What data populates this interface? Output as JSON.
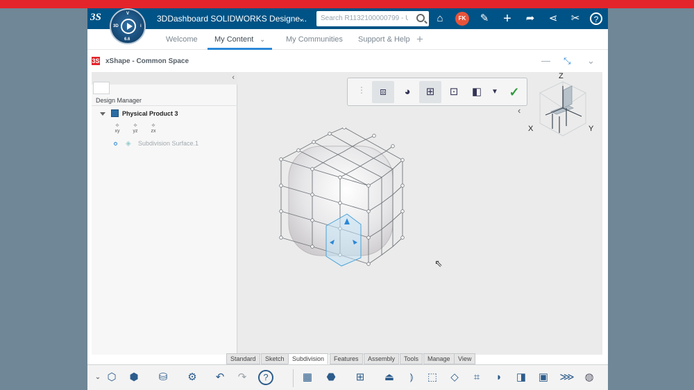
{
  "top_bar": {
    "logo_text": "3S",
    "compass_letters": [
      "3D",
      "V",
      "i",
      "6.6"
    ],
    "title": "3DDashboard SOLIDWORKS Designe...",
    "search_placeholder": "Search R1132100000799 - U",
    "avatar_initials": "FK",
    "accent": "#005386"
  },
  "tabs": [
    {
      "label": "Welcome",
      "active": false
    },
    {
      "label": "My Content",
      "active": true
    },
    {
      "label": "My Communities",
      "active": false
    },
    {
      "label": "Support & Help",
      "active": false
    }
  ],
  "widget": {
    "title": "xShape - Common Space",
    "logo_text": "3S"
  },
  "tree": {
    "header": "Design Manager",
    "product": "Physical Product 3",
    "planes": [
      {
        "icon": "⟡",
        "label": "xy"
      },
      {
        "icon": "⟡",
        "label": "yz"
      },
      {
        "icon": "⟡",
        "label": "zx"
      }
    ],
    "feature": "Subdivision Surface.1"
  },
  "triad": {
    "x": "X",
    "y": "Y",
    "z": "Z"
  },
  "bottom_tabs": [
    {
      "label": "Standard",
      "active": false
    },
    {
      "label": "Sketch",
      "active": false
    },
    {
      "label": "Subdivision",
      "active": true
    },
    {
      "label": "Features",
      "active": false
    },
    {
      "label": "Assembly",
      "active": false
    },
    {
      "label": "Tools",
      "active": false
    },
    {
      "label": "Manage",
      "active": false
    },
    {
      "label": "View",
      "active": false
    }
  ]
}
